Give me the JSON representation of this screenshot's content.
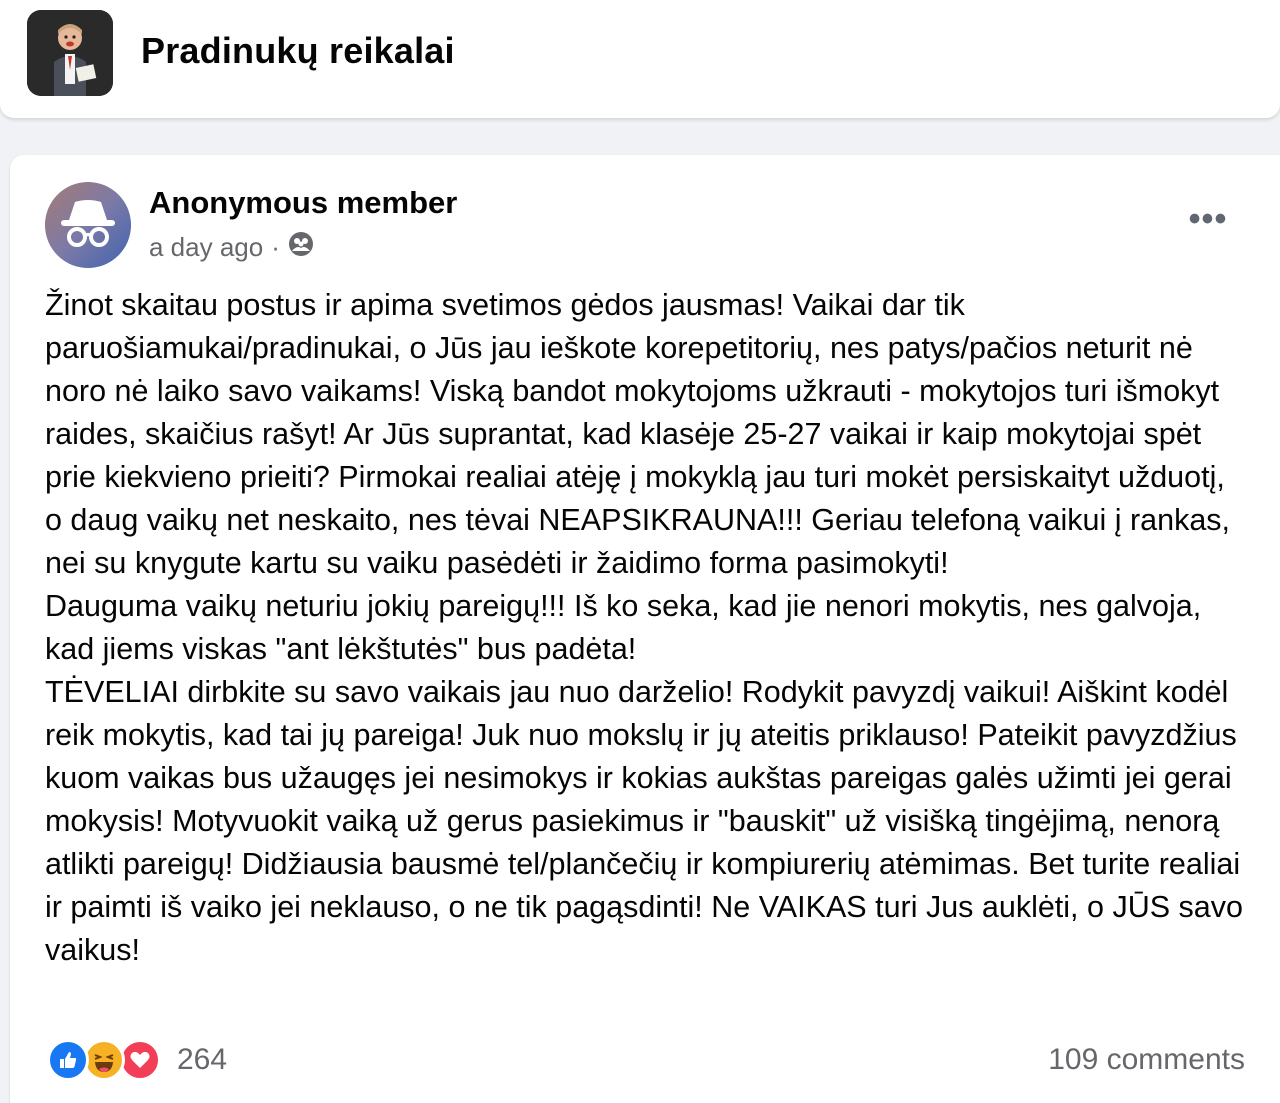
{
  "group": {
    "name": "Pradinukų reikalai"
  },
  "post": {
    "author": "Anonymous member",
    "time": "a day ago",
    "separator": "·",
    "privacy_icon": "group-icon",
    "more_label": "•••",
    "paragraphs": [
      "Žinot skaitau postus ir apima svetimos gėdos jausmas! Vaikai dar tik paruošiamukai/pradinukai, o Jūs jau ieškote korepetitorių, nes patys/pačios neturit nė noro nė laiko savo vaikams!  Viską bandot mokytojoms užkrauti - mokytojos turi išmokyt raides, skaičius rašyt!  Ar Jūs suprantat, kad klasėje 25-27 vaikai ir kaip mokytojai spėt prie kiekvieno prieiti? Pirmokai realiai atėję į mokyklą jau turi mokėt persiskaityt užduotį, o daug vaikų net neskaito, nes tėvai NEAPSIKRAUNA!!! Geriau telefoną vaikui į rankas, nei su knygute kartu su vaiku pasėdėti ir žaidimo forma pasimokyti!",
      "Dauguma vaikų neturiu jokių pareigų!!! Iš ko seka, kad jie nenori mokytis, nes galvoja, kad jiems viskas \"ant lėkštutės\" bus padėta!",
      "TĖVELIAI dirbkite su savo vaikais jau nuo darželio! Rodykit pavyzdį vaikui! Aiškint kodėl reik mokytis, kad tai jų pareiga! Juk nuo mokslų ir jų ateitis priklauso! Pateikit pavyzdžius kuom vaikas bus užaugęs jei nesimokys ir kokias aukštas pareigas galės užimti jei gerai mokysis!  Motyvuokit vaiką už gerus pasiekimus ir \"bauskit\" už visišką tingėjimą, nenorą atlikti pareigų!  Didžiausia bausmė tel/plančečių ir kompiurerių atėmimas. Bet turite realiai ir paimti iš vaiko jei neklauso, o ne tik pagąsdinti! Ne VAIKAS turi Jus auklėti, o JŪS savo vaikus!"
    ],
    "reactions": {
      "icons": [
        "like-icon",
        "haha-icon",
        "love-icon"
      ],
      "count": "264"
    },
    "comments_label": "109 comments"
  },
  "colors": {
    "like": "#1877f2",
    "love": "#f33e58",
    "haha": "#f7b125",
    "secondary_text": "#65676b"
  }
}
